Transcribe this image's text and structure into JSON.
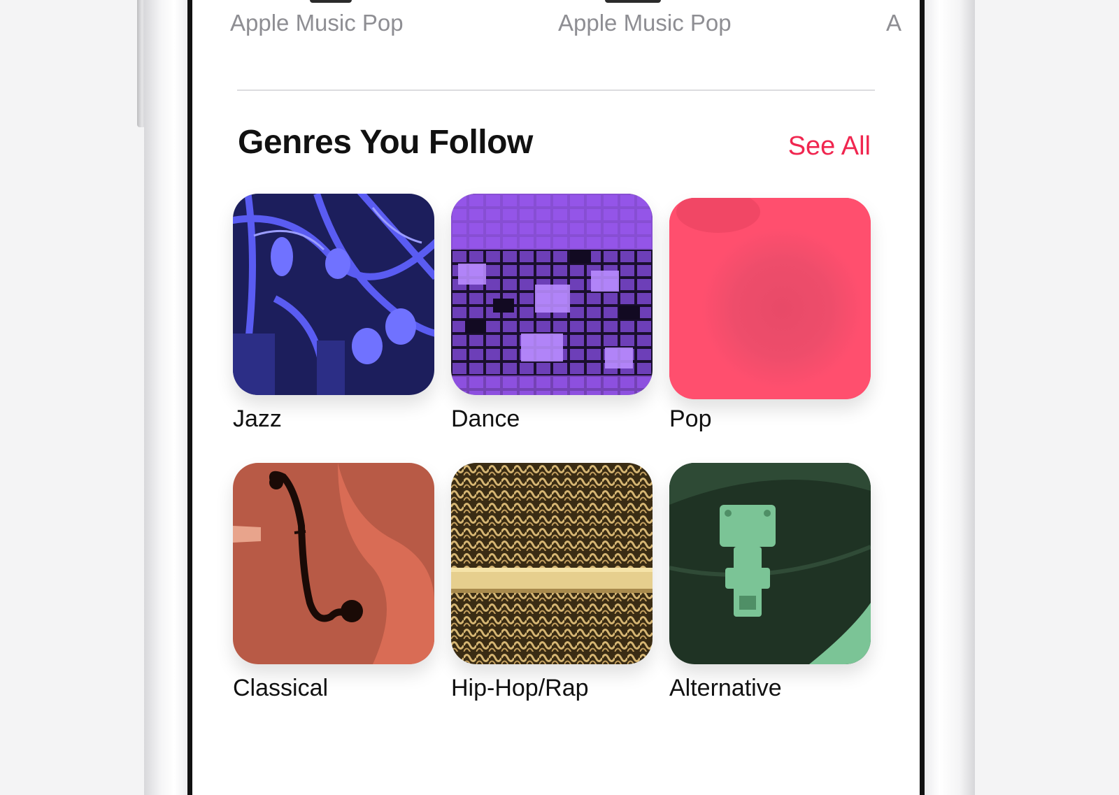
{
  "top_row": {
    "subtitles": [
      "Apple Music Pop",
      "Apple Music Pop",
      "A"
    ]
  },
  "section": {
    "title": "Genres You Follow",
    "see_all": "See All"
  },
  "genres": [
    {
      "name": "Jazz",
      "icon": "saxophone-artwork"
    },
    {
      "name": "Dance",
      "icon": "disco-ball-artwork"
    },
    {
      "name": "Pop",
      "icon": "pink-gradient-artwork"
    },
    {
      "name": "Classical",
      "icon": "violin-artwork"
    },
    {
      "name": "Hip-Hop/Rap",
      "icon": "microphone-artwork"
    },
    {
      "name": "Alternative",
      "icon": "guitar-case-artwork"
    }
  ],
  "colors": {
    "accent": "#f0264f",
    "jazz": "#5a5cf2",
    "dance": "#9b59f0",
    "pop": "#ff4f6e",
    "classical": "#d96c55",
    "hiphop": "#d6b673",
    "alternative": "#7bc496"
  }
}
